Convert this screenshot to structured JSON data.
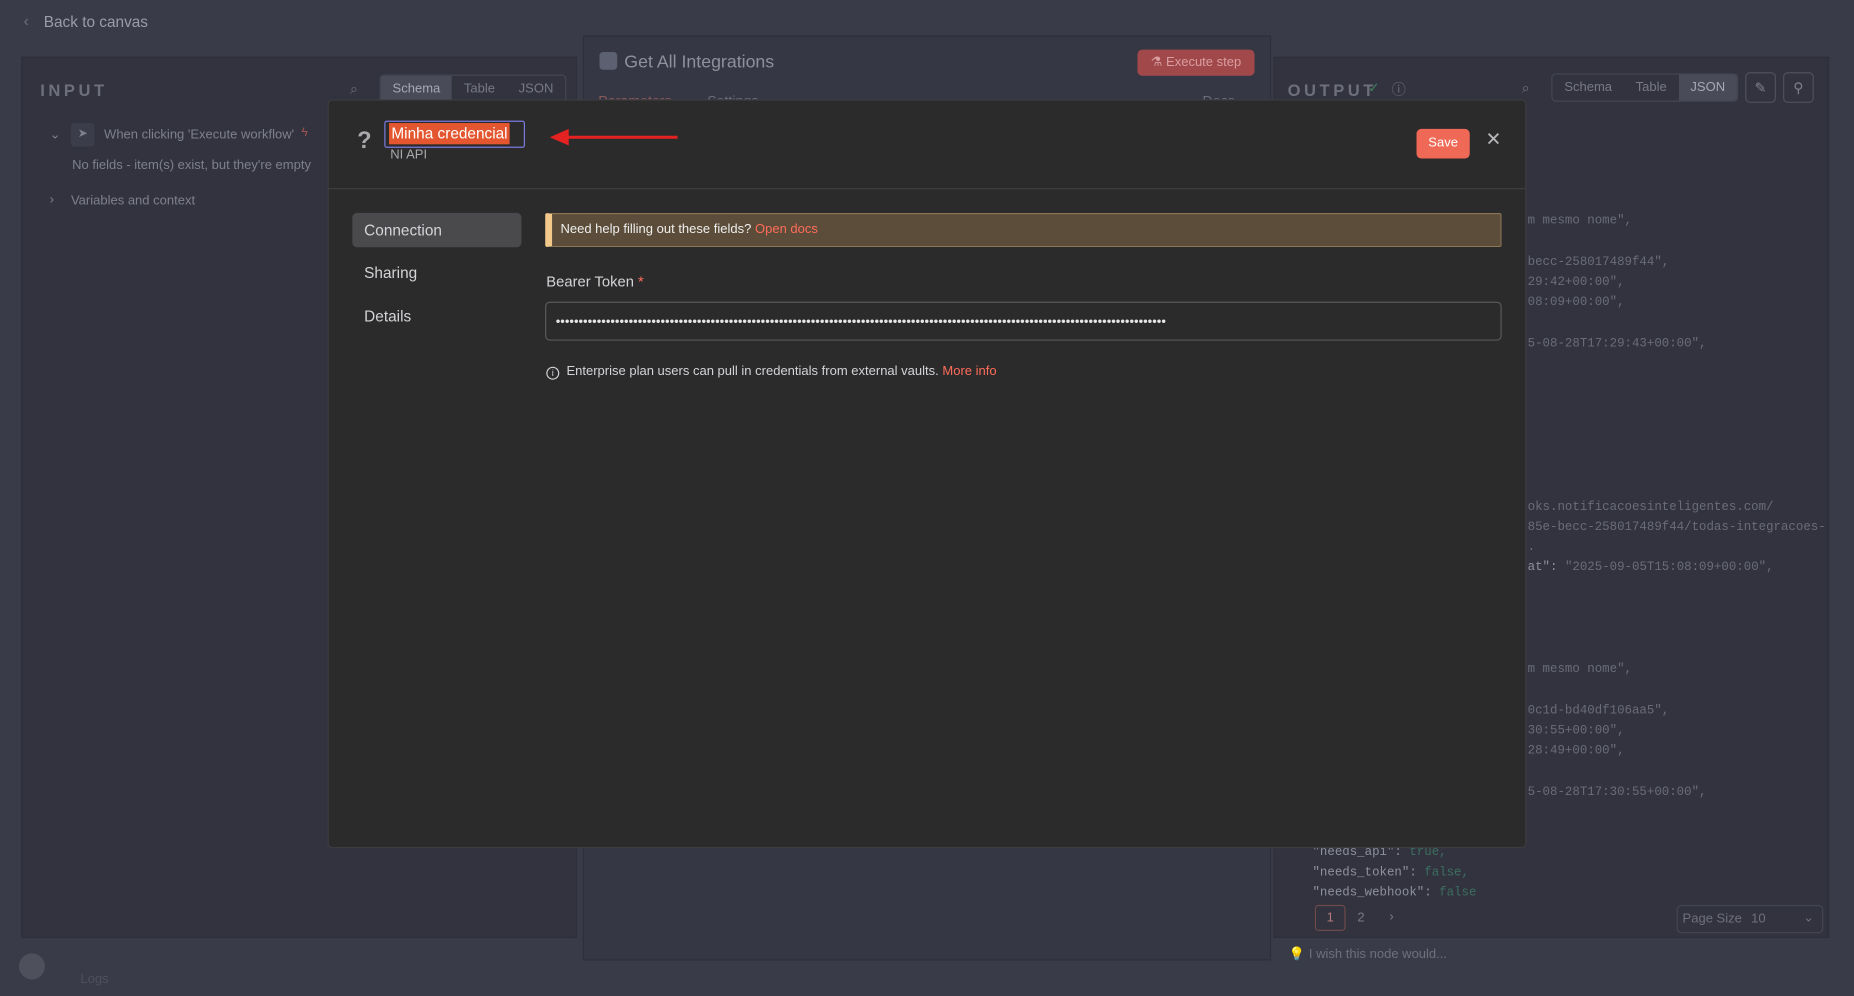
{
  "background": {
    "back_label": "Back to canvas",
    "input": {
      "title": "INPUT",
      "views": [
        "Schema",
        "Table",
        "JSON"
      ],
      "trigger_label": "When clicking 'Execute workflow'",
      "empty_note": "No fields - item(s) exist, but they're empty",
      "variables_label": "Variables and context"
    },
    "node": {
      "title": "Get All Integrations",
      "execute_label": "Execute step",
      "tabs": [
        "Parameters",
        "Settings"
      ],
      "docs_label": "Docs"
    },
    "output": {
      "title": "OUTPUT",
      "views": [
        "Schema",
        "Table",
        "JSON"
      ],
      "json_lines": [
        "m mesmo nome\",",
        "becc-258017489f44\",",
        "29:42+00:00\",",
        "08:09+00:00\",",
        "5-08-28T17:29:43+00:00\",",
        "oks.notificacoesinteligentes.com/",
        "85e-becc-258017489f44/todas-integracoes-",
        "."
      ],
      "json_line_at": {
        "key": "at\":",
        "value": "\"2025-09-05T15:08:09+00:00\","
      },
      "json_lines_2": [
        "m mesmo nome\",",
        "0c1d-bd40df106aa5\",",
        "30:55+00:00\",",
        "28:49+00:00\",",
        "5-08-28T17:30:55+00:00\","
      ],
      "bool_rows": [
        {
          "key": "\"needs_api\":",
          "value": "true,"
        },
        {
          "key": "\"needs_token\":",
          "value": "false,"
        },
        {
          "key": "\"needs_webhook\":",
          "value": "false"
        }
      ],
      "pages": [
        "1",
        "2"
      ],
      "page_size_label": "Page Size",
      "page_size_value": "10",
      "feedback_placeholder": "I wish this node would...",
      "logs_label": "Logs"
    }
  },
  "modal": {
    "credential_name": "Minha credencial",
    "credential_type": "NI API",
    "save_label": "Save",
    "nav": [
      {
        "label": "Connection"
      },
      {
        "label": "Sharing"
      },
      {
        "label": "Details"
      }
    ],
    "notice_text": "Need help filling out these fields?",
    "notice_link": "Open docs",
    "field_label": "Bearer Token",
    "required_mark": "*",
    "token_value": "••••••••••••••••••••••••••••••••••••••••••••••••••••••••••••••••••••••••••••••••••••••••••••••••••••••••••••••••••••••••••••••••••••••",
    "info_text": "Enterprise plan users can pull in credentials from external vaults.",
    "info_link": "More info"
  },
  "colors": {
    "accent": "#ff6d5a",
    "highlight": "#e4562f",
    "annotation_arrow": "#e52222"
  }
}
